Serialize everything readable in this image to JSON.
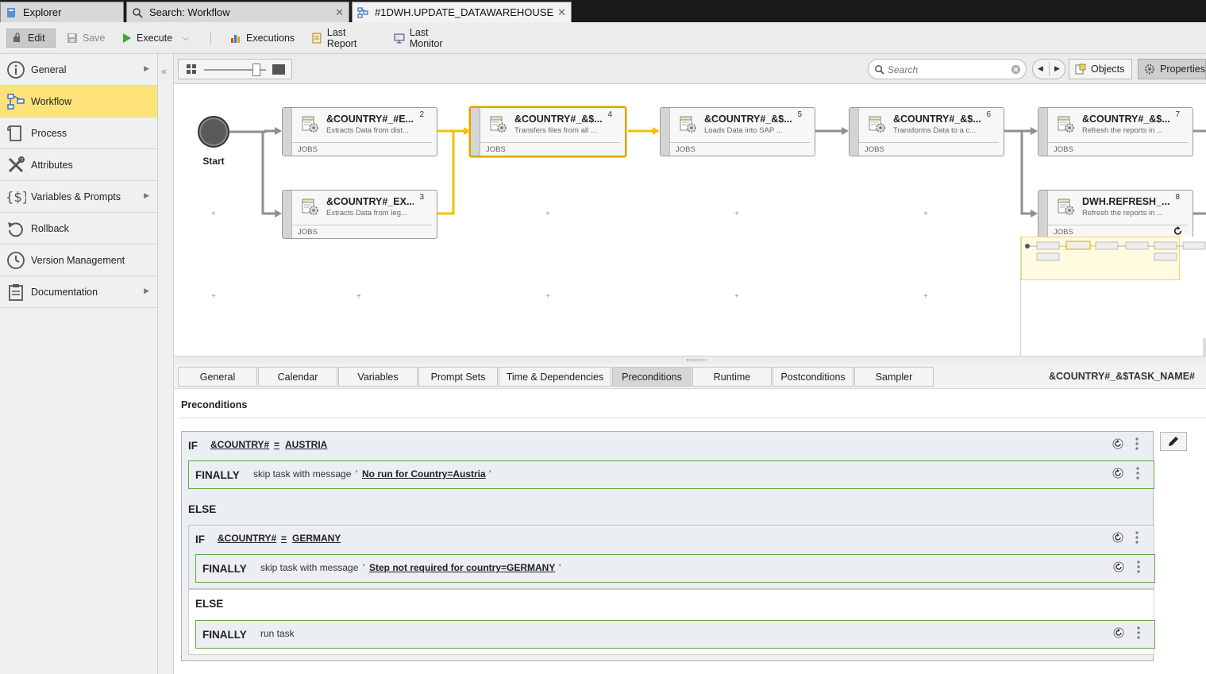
{
  "tabs": [
    {
      "label": "Explorer",
      "icon": "explorer-icon",
      "active": false
    },
    {
      "label": "Search: Workflow",
      "icon": "search-icon",
      "active": false
    },
    {
      "label": "#1DWH.UPDATE_DATAWAREHOUSE",
      "icon": "workflow-icon",
      "active": true
    }
  ],
  "toolbar": {
    "edit": "Edit",
    "save": "Save",
    "execute": "Execute",
    "executions": "Executions",
    "last_report": "Last Report",
    "last_monitor": "Last Monitor"
  },
  "nav": {
    "items": [
      {
        "label": "General",
        "icon": "info-icon",
        "has_submenu": true
      },
      {
        "label": "Workflow",
        "icon": "workflow-icon",
        "active": true
      },
      {
        "label": "Process",
        "icon": "process-icon"
      },
      {
        "label": "Attributes",
        "icon": "tools-icon"
      },
      {
        "label": "Variables & Prompts",
        "icon": "variables-icon",
        "has_submenu": true
      },
      {
        "label": "Rollback",
        "icon": "rollback-icon"
      },
      {
        "label": "Version Management",
        "icon": "clock-icon"
      },
      {
        "label": "Documentation",
        "icon": "clipboard-icon",
        "has_submenu": true
      }
    ]
  },
  "canvas_toolbar": {
    "search_placeholder": "Search",
    "objects": "Objects",
    "properties": "Properties",
    "zoom_level": 0.85
  },
  "workflow": {
    "start_label": "Start",
    "nodes": [
      {
        "num": "2",
        "title": "&COUNTRY#_#E...",
        "desc": "Extracts Data from dist...",
        "type": "JOBS"
      },
      {
        "num": "3",
        "title": "&COUNTRY#_EX...",
        "desc": "Extracts Data from leg...",
        "type": "JOBS"
      },
      {
        "num": "4",
        "title": "&COUNTRY#_&$...",
        "desc": "Transfers files from all ...",
        "type": "JOBS",
        "selected": true
      },
      {
        "num": "5",
        "title": "&COUNTRY#_&$...",
        "desc": "Loads Data into SAP ...",
        "type": "JOBS"
      },
      {
        "num": "6",
        "title": "&COUNTRY#_&$...",
        "desc": "Transforms Data to a c...",
        "type": "JOBS"
      },
      {
        "num": "7",
        "title": "&COUNTRY#_&$...",
        "desc": "Refresh the reports in ...",
        "type": "JOBS"
      },
      {
        "num": "8",
        "title": "DWH.REFRESH_...",
        "desc": "Refresh the reports in ...",
        "type": "JOBS"
      }
    ]
  },
  "prop_tabs": [
    "General",
    "Calendar",
    "Variables",
    "Prompt Sets",
    "Time & Dependencies",
    "Preconditions",
    "Runtime",
    "Postconditions",
    "Sampler"
  ],
  "prop_active_tab": "Preconditions",
  "task_name": "&COUNTRY#_&$TASK_NAME#",
  "preconditions": {
    "title": "Preconditions",
    "kw_if": "IF",
    "kw_finally": "FINALLY",
    "kw_else": "ELSE",
    "eq": "=",
    "quote": "'",
    "cond1": {
      "var": "&COUNTRY#",
      "value": "AUSTRIA"
    },
    "finally1": {
      "action": "skip task with message",
      "message": "No run for Country=Austria"
    },
    "cond2": {
      "var": "&COUNTRY#",
      "value": "GERMANY"
    },
    "finally2": {
      "action": "skip task with message",
      "message": "Step not required for country=GERMANY"
    },
    "finally3": {
      "action": "run task"
    }
  }
}
